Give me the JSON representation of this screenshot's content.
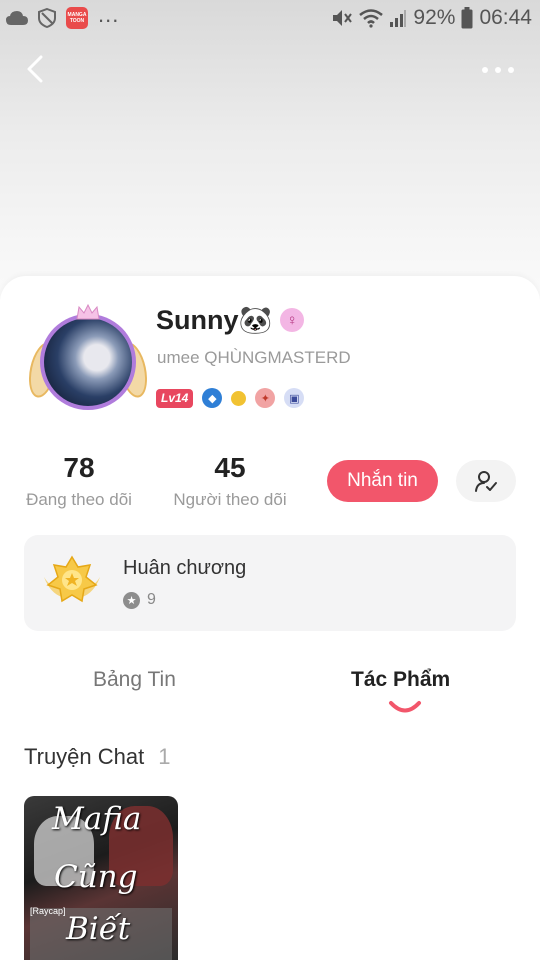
{
  "status_bar": {
    "app_badge_text": "MANGA TOON",
    "dots": "...",
    "battery": "92%",
    "time": "06:44"
  },
  "profile": {
    "name": "Sunny🐼",
    "handle": "umee QHÙNGMASTERD",
    "level": "Lv14"
  },
  "stats": {
    "following_count": "78",
    "following_label": "Đang theo dõi",
    "followers_count": "45",
    "followers_label": "Người theo dõi"
  },
  "actions": {
    "message_label": "Nhắn tin"
  },
  "medals": {
    "title": "Huân chương",
    "count": "9"
  },
  "tabs": [
    {
      "label": "Bảng Tin"
    },
    {
      "label": "Tác Phẩm"
    }
  ],
  "works": {
    "section_title": "Truyện Chat",
    "section_count": "1",
    "items": [
      {
        "cover_text_1": "Mafia",
        "cover_text_2": "Cũng",
        "cover_text_3": "Biết",
        "cover_tag": "[Raycap]"
      }
    ]
  },
  "colors": {
    "accent": "#f2566b",
    "level_badge": "#e8475f",
    "avatar_ring": "#b07cdc"
  }
}
